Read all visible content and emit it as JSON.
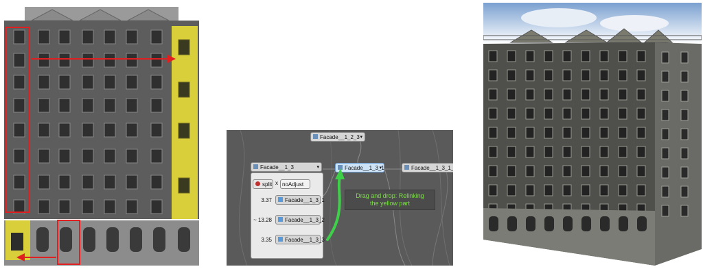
{
  "nodes": {
    "top": "Facade__1_2_3",
    "parent": "Facade__1_3",
    "split_label": "split",
    "split_axis": "x",
    "split_adjust": "noAdjust",
    "child1": "Facade__1_3_1",
    "child2": "Facade__1_3_2",
    "child3": "Facade__1_3_3",
    "selected": "Facade__1_3_1",
    "linked": "Facade__1_3_1_1"
  },
  "values": {
    "v1": "3.37",
    "v2": "~ 13.28",
    "v3": "3.35"
  },
  "annotation": {
    "line1": "Drag and drop: Relinking",
    "line2": "the yellow part"
  },
  "colors": {
    "highlight_yellow": "#d8cf3a",
    "arrow_red": "#e02020",
    "arrow_green": "#3fd04a",
    "graph_bg": "#5a5a5a"
  }
}
